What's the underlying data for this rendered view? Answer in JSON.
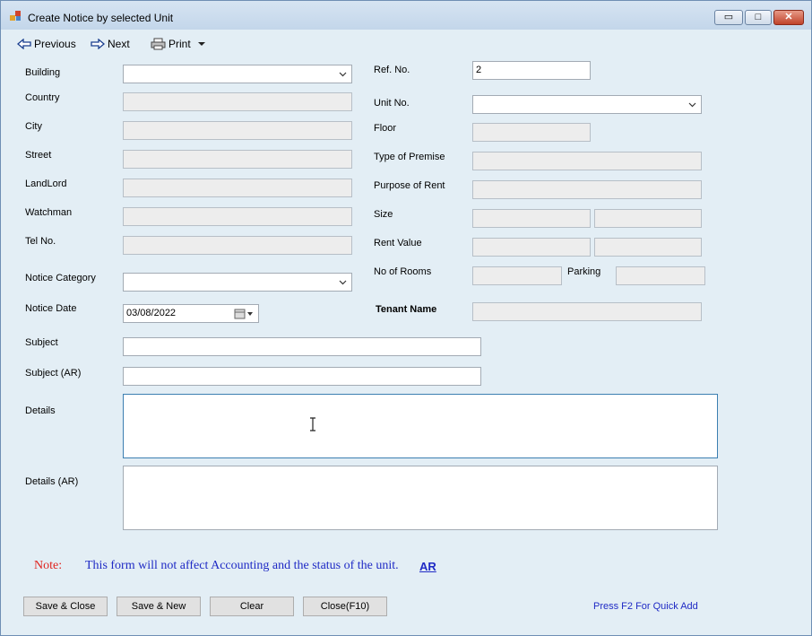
{
  "window": {
    "title": "Create Notice by selected Unit"
  },
  "toolbar": {
    "previous": "Previous",
    "next": "Next",
    "print": "Print"
  },
  "left": {
    "building": "Building",
    "country": "Country",
    "city": "City",
    "street": "Street",
    "landlord": "LandLord",
    "watchman": "Watchman",
    "tel": "Tel No.",
    "notice_category": "Notice Category",
    "notice_date": "Notice Date",
    "notice_date_value": "03/08/2022",
    "subject": "Subject",
    "subject_ar": "Subject (AR)",
    "details": "Details",
    "details_ar": "Details (AR)"
  },
  "right": {
    "ref_no": "Ref. No.",
    "ref_no_value": "2",
    "unit_no": "Unit No.",
    "floor": "Floor",
    "type_of_premise": "Type of Premise",
    "purpose_of_rent": "Purpose of Rent",
    "size": "Size",
    "rent_value": "Rent Value",
    "no_of_rooms": "No of Rooms",
    "parking": "Parking",
    "tenant_name": "Tenant Name"
  },
  "note": {
    "label": "Note:",
    "text": "This form will not affect Accounting and the status of the unit.",
    "link": "AR"
  },
  "buttons": {
    "save_close": "Save & Close",
    "save_new": "Save & New",
    "clear": "Clear",
    "close": "Close(F10)"
  },
  "hint": "Press F2 For Quick Add"
}
